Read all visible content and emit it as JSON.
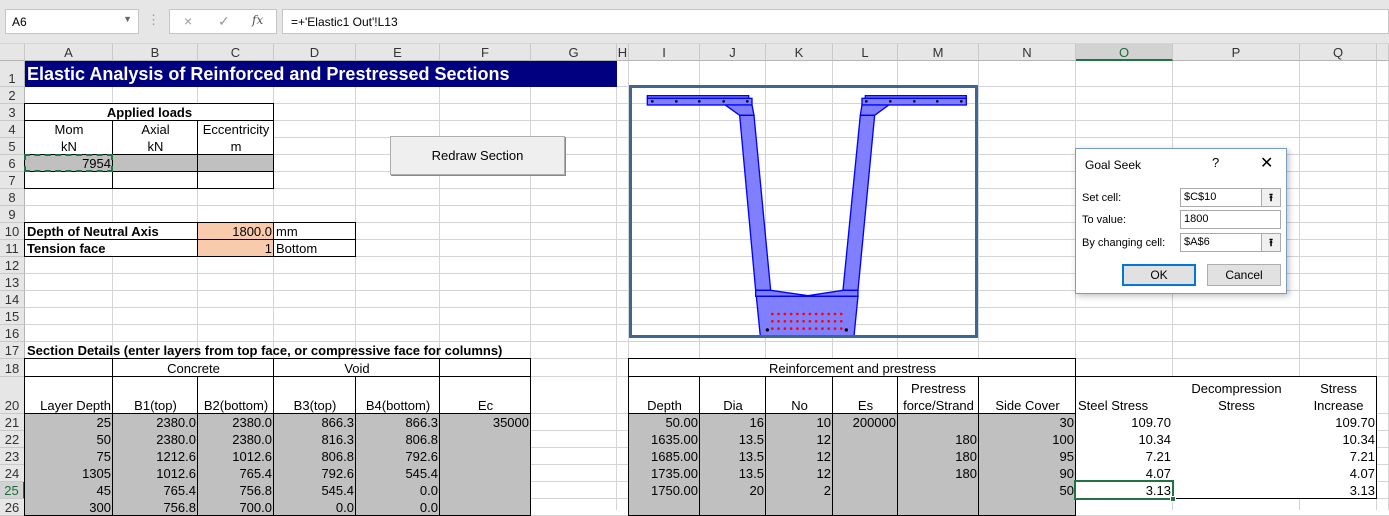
{
  "name_box": "A6",
  "formula": "=+'Elastic1 Out'!L13",
  "formula_icons": {
    "cancel": "×",
    "enter": "✓",
    "fx": "fx"
  },
  "columns": [
    "A",
    "B",
    "C",
    "D",
    "E",
    "F",
    "G",
    "H",
    "I",
    "J",
    "K",
    "L",
    "M",
    "N",
    "O",
    "P",
    "Q"
  ],
  "rows": [
    "1",
    "2",
    "3",
    "4",
    "5",
    "6",
    "7",
    "8",
    "9",
    "10",
    "11",
    "12",
    "13",
    "14",
    "15",
    "16",
    "17",
    "18",
    "20",
    "21",
    "22",
    "23",
    "24",
    "25",
    "26"
  ],
  "active_cell": "O25",
  "cells": {
    "A1": "Elastic Analysis of Reinforced and Prestressed Sections",
    "A3": "Applied loads",
    "A4": "Mom",
    "B4": "Axial",
    "C4": "Eccentricity",
    "A5": "kN",
    "B5": "kN",
    "C5": "m",
    "A6": "7954",
    "A10": "Depth of Neutral Axis",
    "C10": "1800.0",
    "D10": "mm",
    "A11": "Tension face",
    "C11": "1",
    "D11": "Bottom",
    "A17": "Section Details (enter layers from top face, or compressive face for columns)",
    "B18": "Concrete",
    "D18": "Void",
    "I18": "Reinforcement and prestress",
    "A20": "Layer Depth",
    "B20": "B1(top)",
    "C20": "B2(bottom)",
    "D20": "B3(top)",
    "E20": "B4(bottom)",
    "F20": "Ec",
    "I20": "Depth",
    "J20": "Dia",
    "K20": "No",
    "L20": "Es",
    "M20": "Prestress\nforce/Strand",
    "N20": "Side Cover",
    "O20": "Steel Stress",
    "P20": "Decompression\nStress",
    "Q20": "Stress\nIncrease",
    "A21": "25",
    "B21": "2380.0",
    "C21": "2380.0",
    "D21": "866.3",
    "E21": "866.3",
    "F21": "35000",
    "A22": "50",
    "B22": "2380.0",
    "C22": "2380.0",
    "D22": "816.3",
    "E22": "806.8",
    "A23": "75",
    "B23": "1212.6",
    "C23": "1012.6",
    "D23": "806.8",
    "E23": "792.6",
    "A24": "1305",
    "B24": "1012.6",
    "C24": "765.4",
    "D24": "792.6",
    "E24": "545.4",
    "A25": "45",
    "B25": "765.4",
    "C25": "756.8",
    "D25": "545.4",
    "E25": "0.0",
    "A26": "300",
    "B26": "756.8",
    "C26": "700.0",
    "D26": "0.0",
    "E26": "0.0",
    "I21": "50.00",
    "J21": "16",
    "K21": "10",
    "L21": "200000",
    "N21": "30",
    "O21": "109.70",
    "Q21": "109.70",
    "I22": "1635.00",
    "J22": "13.5",
    "K22": "12",
    "M22": "180",
    "N22": "100",
    "O22": "10.34",
    "Q22": "10.34",
    "I23": "1685.00",
    "J23": "13.5",
    "K23": "12",
    "M23": "180",
    "N23": "95",
    "O23": "7.21",
    "Q23": "7.21",
    "I24": "1735.00",
    "J24": "13.5",
    "K24": "12",
    "M24": "180",
    "N24": "90",
    "O24": "4.07",
    "Q24": "4.07",
    "I25": "1750.00",
    "J25": "20",
    "K25": "2",
    "N25": "50",
    "O25": "3.13",
    "Q25": "3.13"
  },
  "redraw_button": "Redraw Section",
  "goal_seek": {
    "title": "Goal Seek",
    "help": "?",
    "close": "✕",
    "set_cell_label": "Set cell:",
    "set_cell_value": "$C$10",
    "to_value_label": "To value:",
    "to_value_value": "1800",
    "changing_cell_label": "By changing cell:",
    "changing_cell_value": "$A$6",
    "collapse_icon": "⭱",
    "ok": "OK",
    "cancel": "Cancel"
  },
  "colors": {
    "title_fill": "#000080",
    "input_fill": "#c0c0c0",
    "peach_fill": "#f8cbad",
    "section_fill": "#8080ff",
    "section_edge": "#0000ff",
    "strand": "#ff0000",
    "excel_green": "#217346"
  }
}
